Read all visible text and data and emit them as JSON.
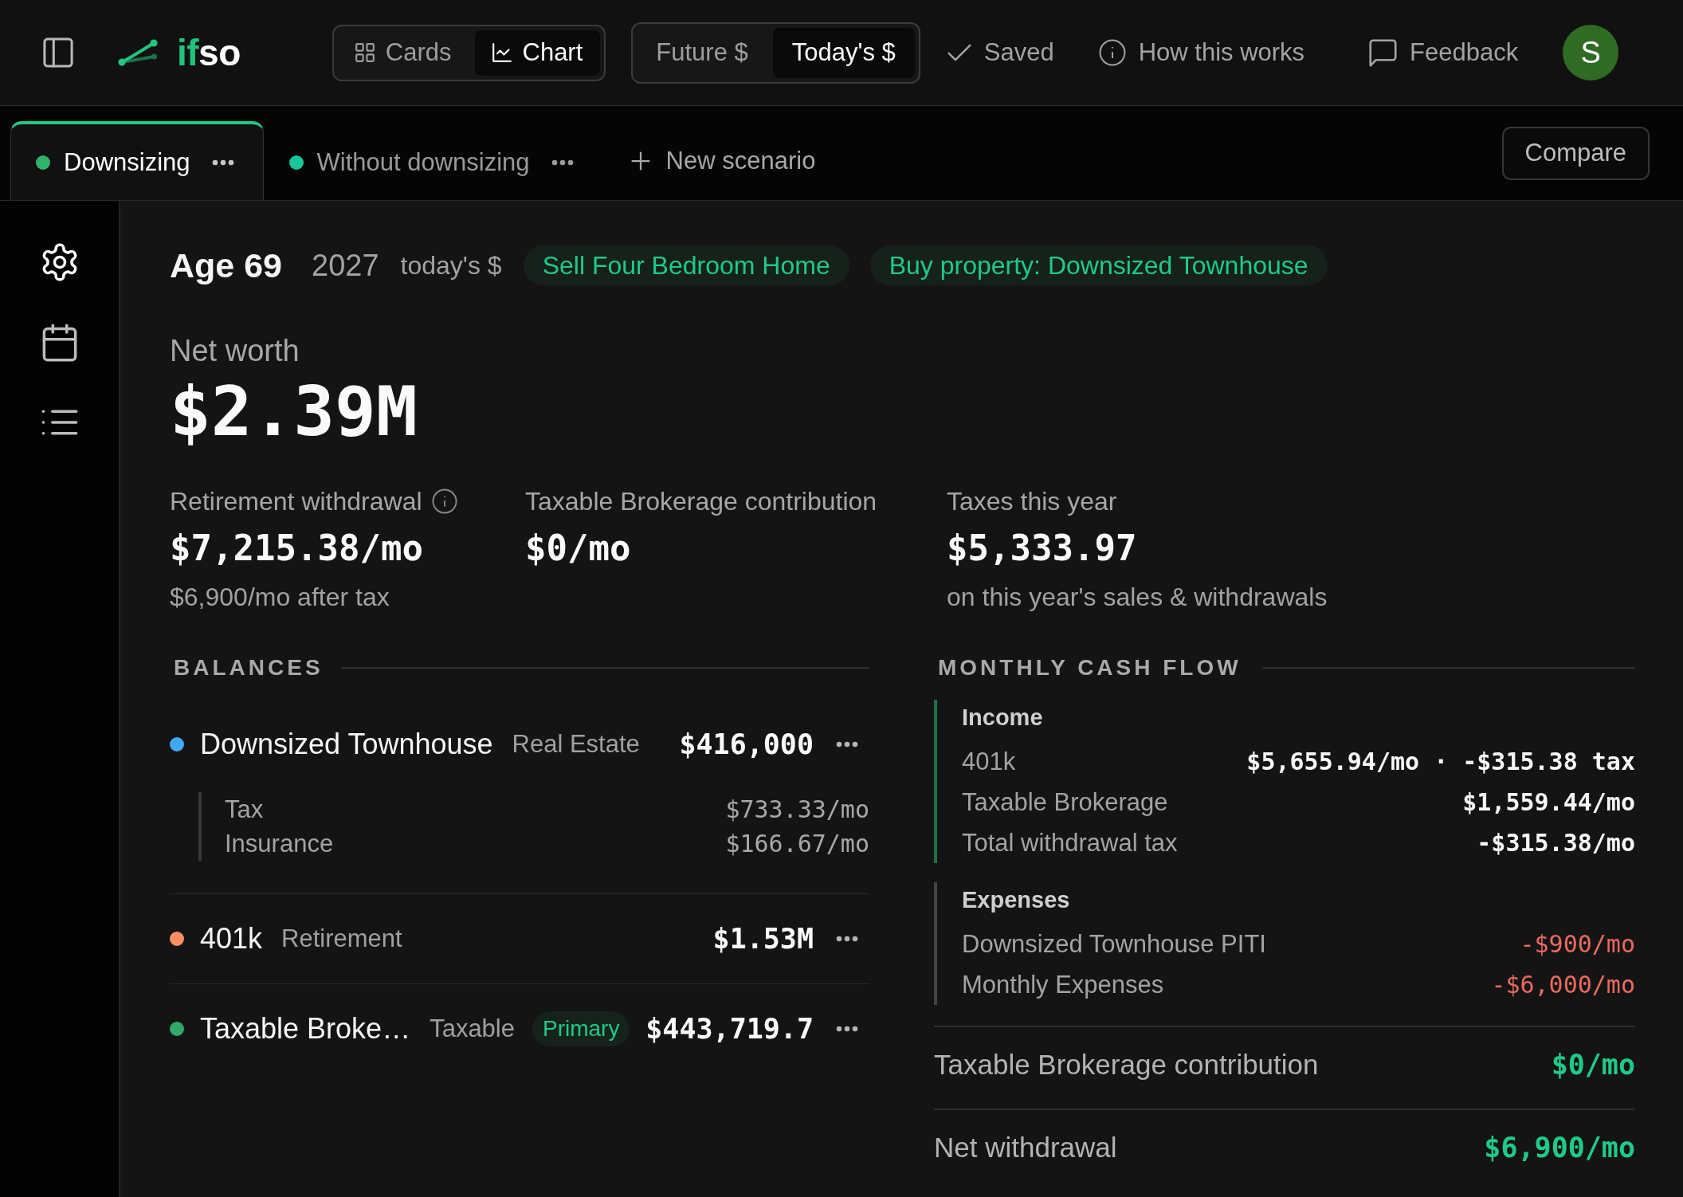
{
  "top_bar": {
    "logo": {
      "accent_text": "if",
      "text": "so"
    },
    "view_toggle": [
      {
        "label": "Cards",
        "selected": false
      },
      {
        "label": "Chart",
        "selected": true
      }
    ],
    "currency_toggle": [
      {
        "label": "Future $",
        "selected": false
      },
      {
        "label": "Today's $",
        "selected": true
      }
    ],
    "actions": [
      {
        "label": "Saved"
      },
      {
        "label": "How this works"
      },
      {
        "label": "Feedback"
      }
    ],
    "avatar": {
      "initial": "S"
    }
  },
  "scenario_tabs": [
    {
      "label": "Downsizing",
      "color": "#2fb36b",
      "selected": true
    },
    {
      "label": "Without downsizing",
      "color": "#17c69d",
      "selected": false
    }
  ],
  "new_scenario_button": {
    "label": "New scenario"
  },
  "compare_button": {
    "label": "Compare"
  },
  "sidebar_items": [
    {
      "selected": true
    },
    {
      "selected": false
    },
    {
      "selected": false
    }
  ],
  "header": {
    "age": "Age 69",
    "year": "2027",
    "currency_mode": "today's $",
    "events": [
      "Sell Four Bedroom Home",
      "Buy property: Downsized Townhouse"
    ]
  },
  "net_worth": {
    "label": "Net worth",
    "value": "$2.39M"
  },
  "metrics": [
    {
      "label": "Retirement withdrawal",
      "info": true,
      "value": "$7,215.38/mo",
      "note": "$6,900/mo after tax"
    },
    {
      "label": "Taxable Brokerage contribution",
      "info": false,
      "value": "$0/mo"
    },
    {
      "label": "Taxes this year",
      "info": false,
      "value": "$5,333.97",
      "note": "on this year's sales & withdrawals"
    }
  ],
  "balances": {
    "title": "BALANCES",
    "accounts": [
      {
        "name": "Downsized Townhouse",
        "type": "Real Estate",
        "color": "#3ea9ef",
        "value": "$416,000",
        "details": [
          {
            "label": "Tax",
            "value": "$733.33/mo"
          },
          {
            "label": "Insurance",
            "value": "$166.67/mo"
          }
        ]
      },
      {
        "name": "401k",
        "type": "Retirement",
        "color": "#ff8f61",
        "value": "$1.53M"
      },
      {
        "name": "Taxable Broke…",
        "type": "Taxable",
        "badge": "Primary",
        "color": "#2faa67",
        "value": "$443,719.7"
      }
    ]
  },
  "cash_flow": {
    "title": "MONTHLY CASH FLOW",
    "groups": [
      {
        "kind": "income",
        "title": "Income",
        "rows": [
          {
            "label": "401k",
            "value": "$5,655.94/mo · -$315.38 tax"
          },
          {
            "label": "Taxable Brokerage",
            "value": "$1,559.44/mo"
          },
          {
            "label": "Total withdrawal tax",
            "value": "-$315.38/mo"
          }
        ]
      },
      {
        "kind": "expense",
        "title": "Expenses",
        "rows": [
          {
            "label": "Downsized Townhouse PITI",
            "value": "-$900/mo"
          },
          {
            "label": "Monthly Expenses",
            "value": "-$6,000/mo"
          }
        ]
      }
    ],
    "totals": [
      {
        "label": "Taxable Brokerage contribution",
        "value": "$0/mo"
      },
      {
        "label": "Net withdrawal",
        "value": "$6,900/mo"
      }
    ]
  }
}
